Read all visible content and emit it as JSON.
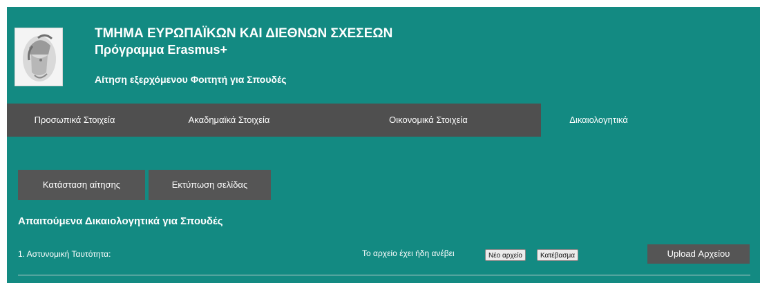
{
  "header": {
    "title": "ΤΜΗΜΑ ΕΥΡΩΠΑΪΚΩΝ ΚΑΙ ΔΙΕΘΝΩΝ ΣΧΕΣΕΩΝ",
    "subtitle": "Πρόγραμμα Erasmus+",
    "application_title": "Αίτηση εξερχόμενου Φοιτητή για Σπουδές"
  },
  "tabs": [
    {
      "label": "Προσωπικά Στοιχεία"
    },
    {
      "label": "Ακαδημαϊκά Στοιχεία"
    },
    {
      "label": "Οικονομικά Στοιχεία"
    },
    {
      "label": "Δικαιολογητικά"
    }
  ],
  "actions": {
    "status_label": "Κατάσταση αίτησης",
    "print_label": "Εκτύπωση σελίδας"
  },
  "documents": {
    "section_title": "Απαιτούμενα Δικαιολογητικά για Σπουδές",
    "items": [
      {
        "label": "1. Αστυνομική Ταυτότητα:",
        "status": "Το αρχείο έχει ήδη ανέβει",
        "new_file_label": "Νέο αρχείο",
        "download_label": "Κατέβασμα",
        "upload_label": "Upload Αρχείου"
      }
    ]
  }
}
